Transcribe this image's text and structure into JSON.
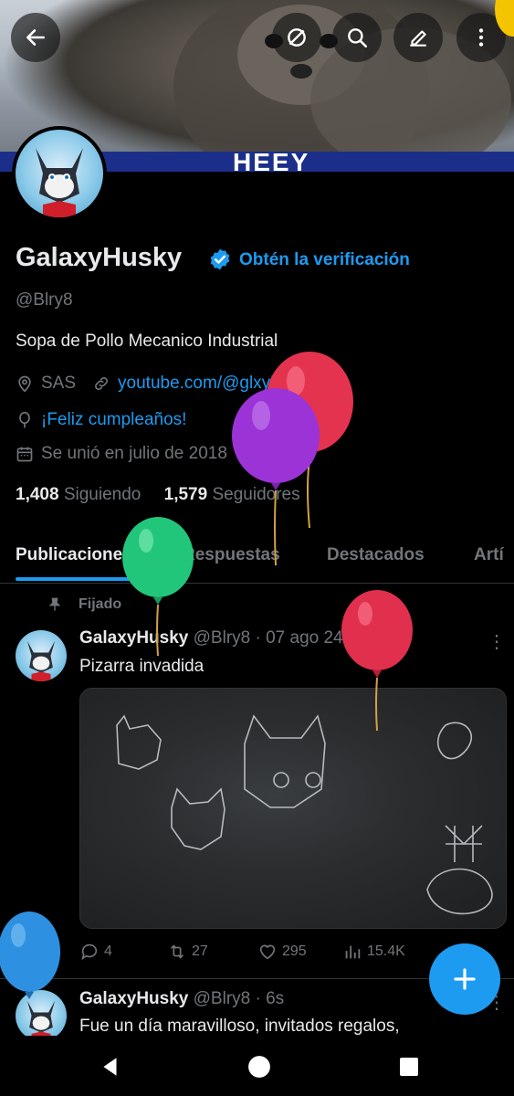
{
  "profile": {
    "name": "GalaxyHusky",
    "verify_label": "Obtén la verificación",
    "handle": "@Blry8",
    "bio": "Sopa de Pollo Mecanico Industrial",
    "location": "SAS",
    "website": "youtube.com/@glxyhsky9596",
    "birthday": "¡Feliz cumpleaños!",
    "joined": "Se unió en julio de 2018",
    "following_count": "1,408",
    "following_label": "Siguiendo",
    "followers_count": "1,579",
    "followers_label": "Seguidores"
  },
  "tabs": [
    "Publicaciones",
    "Respuestas",
    "Destacados",
    "Artí"
  ],
  "pinned_label": "Fijado",
  "posts": [
    {
      "author": "GalaxyHusky",
      "meta": "@Blry8 · 07 ago 24",
      "text": "Pizarra invadida",
      "replies": "4",
      "reposts": "27",
      "likes": "295",
      "views": "15.4K"
    },
    {
      "author": "GalaxyHusky",
      "meta": "@Blry8 · 6s",
      "text": "Fue un día maravilloso, invitados regalos,"
    }
  ],
  "colors": {
    "accent": "#1d9bf0",
    "background": "#000000",
    "muted": "#71767b",
    "text": "#e7e9ea"
  },
  "icons": [
    "back-arrow-icon",
    "hide-icon",
    "search-icon",
    "edit-icon",
    "more-vertical-icon",
    "verified-badge-icon",
    "location-icon",
    "link-icon",
    "balloon-icon",
    "calendar-icon",
    "pin-icon",
    "reply-icon",
    "repost-icon",
    "like-icon",
    "views-icon",
    "compose-plus-icon"
  ]
}
